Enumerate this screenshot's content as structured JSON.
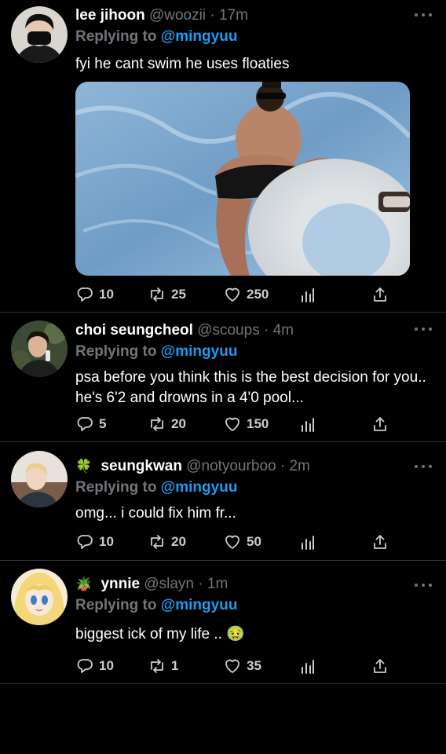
{
  "tweets": [
    {
      "name": "lee jihoon",
      "handle": "@woozii",
      "dot": "·",
      "time": "17m",
      "replying_prefix": "Replying to",
      "replying_to": "@mingyuu",
      "text": "fyi he cant swim he uses floaties",
      "has_media": true,
      "replies": "10",
      "retweets": "25",
      "likes": "250"
    },
    {
      "name": "choi seungcheol",
      "handle": "@scoups",
      "dot": "·",
      "time": "4m",
      "replying_prefix": "Replying to",
      "replying_to": "@mingyuu",
      "text": "psa before you think this is the best decision for you.. he's 6'2 and drowns in a 4'0 pool...",
      "replies": "5",
      "retweets": "20",
      "likes": "150"
    },
    {
      "name": "seungkwan",
      "name_emoji": "🍀",
      "handle": "@notyourboo",
      "dot": "·",
      "time": "2m",
      "replying_prefix": "Replying to",
      "replying_to": "@mingyuu",
      "text": "omg... i could fix him fr...",
      "replies": "10",
      "retweets": "20",
      "likes": "50"
    },
    {
      "name": "ynnie",
      "name_emoji": "🪴",
      "handle": "@slayn",
      "dot": "·",
      "time": "1m",
      "replying_prefix": "Replying to",
      "replying_to": "@mingyuu",
      "text": "biggest ick of my life .. 🤢",
      "replies": "10",
      "retweets": "1",
      "likes": "35"
    }
  ],
  "icons": {
    "reply": "reply-icon",
    "retweet": "retweet-icon",
    "like": "heart-icon",
    "analytics": "analytics-icon",
    "share": "share-icon",
    "more": "more-icon"
  },
  "colors": {
    "background": "#000000",
    "mention": "#1d9bf0",
    "muted": "#71767b",
    "divider": "#2f3336"
  }
}
